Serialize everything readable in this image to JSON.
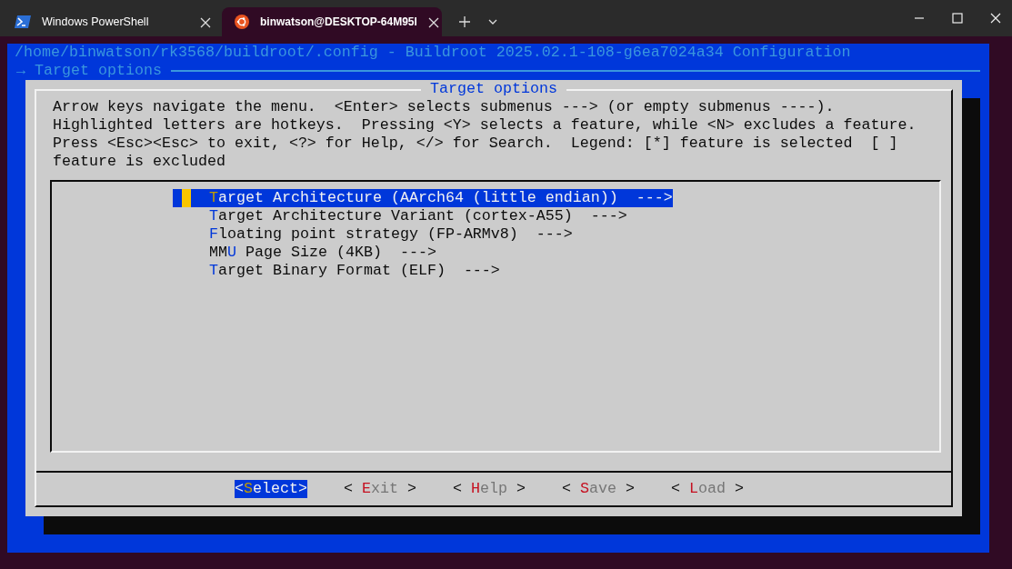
{
  "tabs": [
    {
      "label": "Windows PowerShell",
      "kind": "powershell",
      "selected": false
    },
    {
      "label": "binwatson@DESKTOP-64M95I",
      "kind": "ubuntu",
      "selected": true
    }
  ],
  "terminal": {
    "title": "/home/binwatson/rk3568/buildroot/.config - Buildroot 2025.02.1-108-g6ea7024a34 Configuration",
    "breadcrumb": "→ Target options",
    "dialog": {
      "title": "Target options",
      "help": "Arrow keys navigate the menu.  <Enter> selects submenus ---> (or empty submenus ----).  Highlighted letters are hotkeys.  Pressing <Y> selects a feature, while <N> excludes a feature.  Press <Esc><Esc> to exit, <?> for Help, </> for Search.  Legend: [*] feature is selected  [ ] feature is excluded",
      "items": [
        {
          "hotkey": "T",
          "after": "arget Architecture (AArch64 (little endian))  --->",
          "selected": true
        },
        {
          "hotkey": "T",
          "after": "arget Architecture Variant (cortex-A55)  --->",
          "selected": false
        },
        {
          "hotkey": "F",
          "after": "loating point strategy (FP-ARMv8)  --->",
          "selected": false
        },
        {
          "before": "MM",
          "hotkey": "U",
          "after": " Page Size (4KB)  --->",
          "selected": false
        },
        {
          "hotkey": "T",
          "after": "arget Binary Format (ELF)  --->",
          "selected": false
        }
      ],
      "buttons": [
        {
          "open": "<",
          "hotkey": "S",
          "after": "elect",
          "close": ">",
          "selected": true
        },
        {
          "open": "< ",
          "hotkey": "E",
          "after": "xit",
          "close": " >",
          "selected": false
        },
        {
          "open": "< ",
          "hotkey": "H",
          "after": "elp",
          "close": " >",
          "selected": false
        },
        {
          "open": "< ",
          "hotkey": "S",
          "after": "ave",
          "close": " >",
          "selected": false
        },
        {
          "open": "< ",
          "hotkey": "L",
          "after": "oad",
          "close": " >",
          "selected": false
        }
      ]
    }
  }
}
